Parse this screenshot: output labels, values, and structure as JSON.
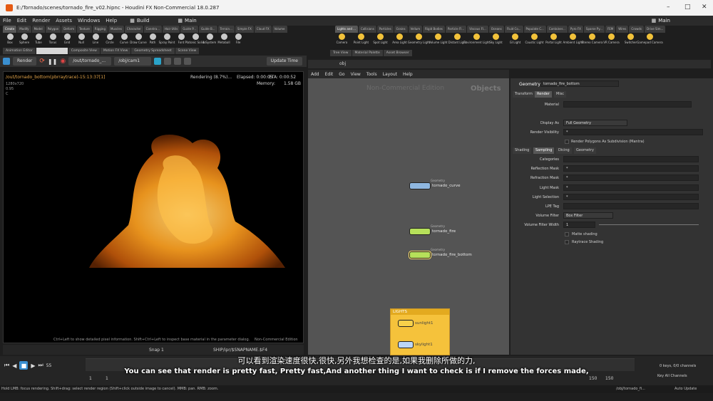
{
  "window": {
    "title": "E:/Tornado/scenes/tornado_fire_v02.hipnc - Houdini FX Non-Commercial 18.0.287"
  },
  "menubar": {
    "items": [
      "File",
      "Edit",
      "Render",
      "Assets",
      "Windows",
      "Help"
    ],
    "desktop": "Build",
    "main": "Main"
  },
  "right_desktop": "Main",
  "shelf_left": {
    "tabs": [
      "Create",
      "Modify",
      "Model",
      "Polygon",
      "Deform",
      "Texture",
      "Rigging",
      "Muscles",
      "Character",
      "Constra...",
      "Hair Utils",
      "Guide P...",
      "Guide B...",
      "Terrain...",
      "Simple FX",
      "Cloud FX",
      "Volume"
    ],
    "tools": [
      "Box",
      "Sphere",
      "Tube",
      "Torus",
      "Grid",
      "Null",
      "Line",
      "Circle",
      "Curve",
      "Draw Curve",
      "Path",
      "Spray Paint",
      "Font",
      "Platonic Solids",
      "L-System",
      "Metaball",
      "File"
    ]
  },
  "shelf_right": {
    "tabs": [
      "Lights and ...",
      "Collisions",
      "Particles",
      "Grains",
      "Vellum",
      "Rigid Bodies",
      "Particle Fl...",
      "Viscous Fl...",
      "Oceans",
      "Fluid Co...",
      "Populate C...",
      "Container...",
      "Pyro FX",
      "Sparse Py...",
      "FEM",
      "Wires",
      "Crowds",
      "Drive Sim..."
    ],
    "tools": [
      "Camera",
      "Point Light",
      "Spot Light",
      "Area Light",
      "Geometry Light",
      "Volume Light",
      "Distant Light",
      "Environment Light",
      "Sky Light",
      "GI Light",
      "Caustic Light",
      "Portal Light",
      "Ambient Light",
      "Stereo Camera",
      "VR Camera",
      "Switcher",
      "Gamepad Camera"
    ]
  },
  "pane_tabs_left": [
    "Animation Editor",
    "",
    "Composite View",
    "Motion FX View",
    "Geometry Spreadsheet",
    "Scene View"
  ],
  "pane_tabs_right": [
    "Tree View",
    "Material Palette",
    "Asset Browser"
  ],
  "render_view": {
    "render_button": "Render",
    "rop_path": "/out/tornado_...",
    "camera": "/obj/cam1",
    "update_button": "Update Time",
    "image_label": "/out/tornado_bottom(pbrraytrace)-15:13:37[1]",
    "resolution": "1280x720",
    "fps": "0.95",
    "channel": "C",
    "progress_text": "Rendering (8.7%)...",
    "elapsed": "Elapsed: 0:00:05",
    "eta": "ETA: 0:00:52",
    "memory_label": "Memory:",
    "memory_value": "1.58 GB",
    "hint": "Ctrl+Left to show detailed pixel information. Shift+Ctrl+Left to inspect base material in the parameter dialog.",
    "watermark": "Non-Commercial Edition",
    "snap": "Snap 1",
    "ship_path": "SHIP/ipr/$SNAPNAME.$F4"
  },
  "network": {
    "path": "obj",
    "menu": [
      "Add",
      "Edit",
      "Go",
      "View",
      "Tools",
      "Layout",
      "Help"
    ],
    "watermark": "Non-Commercial Edition",
    "context": "Objects",
    "nodes": [
      {
        "type": "Geometry",
        "name": "tornado_curve",
        "color": "#8fb7e0"
      },
      {
        "type": "Geometry",
        "name": "tornado_fire",
        "color": "#b6e05a"
      },
      {
        "type": "Geometry",
        "name": "tornado_fire_bottom",
        "color": "#b6e05a"
      }
    ],
    "lights_box": {
      "title": "LIGHTS",
      "nodes": [
        "sunlight1",
        "skylight1"
      ]
    }
  },
  "params": {
    "op_type": "Geometry",
    "op_name": "tornado_fire_bottom",
    "tabs": [
      "Transform",
      "Render",
      "Misc"
    ],
    "material_label": "Material",
    "display_as_label": "Display As",
    "display_as_value": "Full Geometry",
    "render_visibility_label": "Render Visibility",
    "render_visibility_value": "*",
    "subdivision_label": "Render Polygons As Subdivision (Mantra)",
    "subtabs": [
      "Shading",
      "Sampling",
      "Dicing",
      "Geometry"
    ],
    "categories_label": "Categories",
    "reflection_mask_label": "Reflection Mask",
    "reflection_mask_value": "*",
    "refraction_mask_label": "Refraction Mask",
    "refraction_mask_value": "*",
    "light_mask_label": "Light Mask",
    "light_mask_value": "*",
    "light_selection_label": "Light Selection",
    "light_selection_value": "*",
    "lpe_tag_label": "LPE Tag",
    "volume_filter_label": "Volume Filter",
    "volume_filter_value": "Box Filter",
    "volume_filter_width_label": "Volume Filter Width",
    "volume_filter_width_value": "1",
    "matte_label": "Matte shading",
    "raytrace_label": "Raytrace Shading"
  },
  "timeline": {
    "frame": "55",
    "start": "1",
    "start2": "1",
    "end": "150",
    "end2": "150",
    "keys": "0 keys, 0/0 channels",
    "key_all": "Key All Channels",
    "obj_path": "/obj/tornado_fi...",
    "auto_update": "Auto Update"
  },
  "subtitles": {
    "zh": "可以看到渲染速度很快,很快,另外我想检查的是,如果我删除所做的力,",
    "en": "You can see that render is pretty fast, Pretty fast,And another thing I want to check is if I remove the forces made,"
  },
  "help": "Hold LMB: focus rendering. Shift+drag: select render region (Shift+click outside image to cancel). MMB: pan. RMB: zoom."
}
